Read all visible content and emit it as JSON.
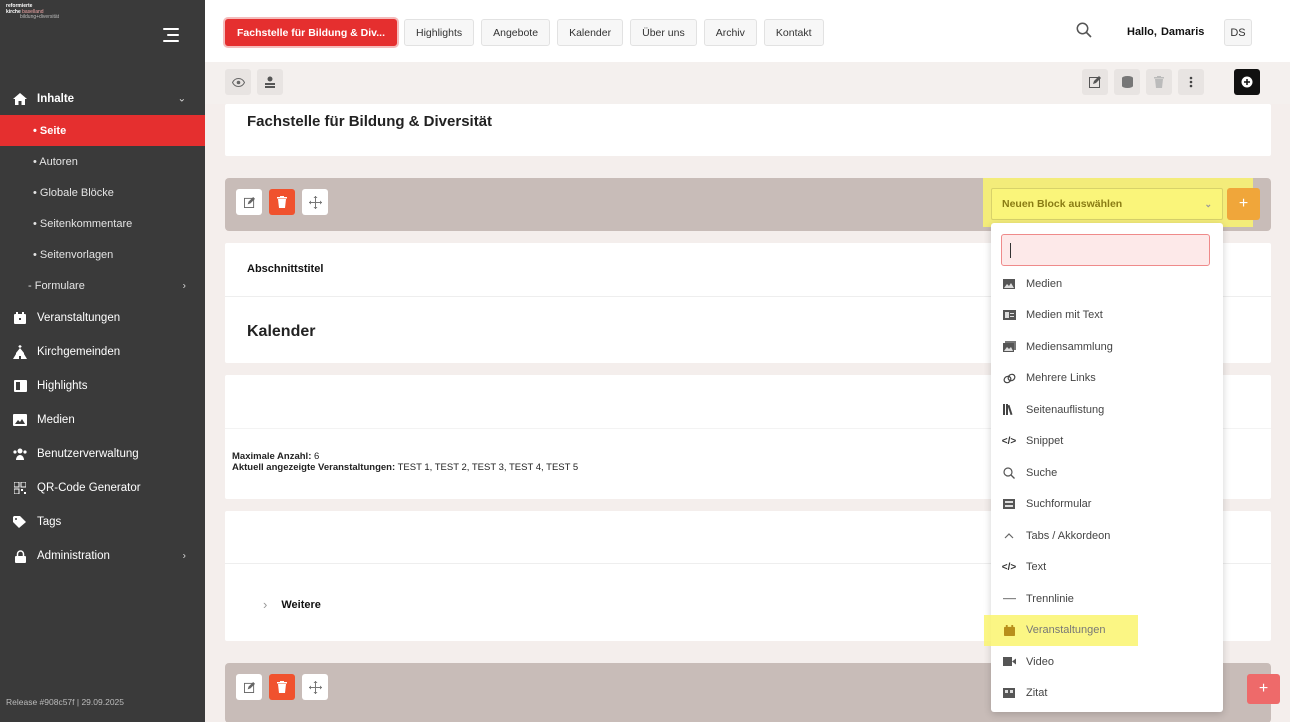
{
  "sidebar": {
    "logo": {
      "line1": "reformierte",
      "line2a": "kirche",
      "line2b": "baselland",
      "line3": "bildung+diversität"
    },
    "items": [
      {
        "label": "Inhalte",
        "icon": "home-icon",
        "chevron": "⌄"
      },
      {
        "label": "• Seite"
      },
      {
        "label": "• Autoren"
      },
      {
        "label": "• Globale Blöcke"
      },
      {
        "label": "• Seitenkommentare"
      },
      {
        "label": "• Seitenvorlagen"
      },
      {
        "label": "- Formulare",
        "chevron": "›"
      },
      {
        "label": "Veranstaltungen",
        "icon": "calendar-icon"
      },
      {
        "label": "Kirchgemeinden",
        "icon": "church-icon"
      },
      {
        "label": "Highlights",
        "icon": "highlights-icon"
      },
      {
        "label": "Medien",
        "icon": "image-icon"
      },
      {
        "label": "Benutzerverwaltung",
        "icon": "users-icon"
      },
      {
        "label": "QR-Code Generator",
        "icon": "qr-code-icon"
      },
      {
        "label": "Tags",
        "icon": "tag-icon"
      },
      {
        "label": "Administration",
        "icon": "lock-icon",
        "chevron": "›"
      }
    ],
    "release": "Release #908c57f | 29.09.2025"
  },
  "topbar": {
    "tabs": [
      "Fachstelle für Bildung & Div...",
      "Highlights",
      "Angebote",
      "Kalender",
      "Über uns",
      "Archiv",
      "Kontakt"
    ],
    "greeting": "Hallo,",
    "user_name": "Damaris",
    "initials": "DS"
  },
  "page": {
    "title": "Fachstelle für Bildung & Diversität",
    "section_label": "Abschnittstitel",
    "section_title": "Kalender",
    "max_label": "Maximale Anzahl:",
    "max_value": "6",
    "events_label": "Aktuell angezeigte Veranstaltungen:",
    "events_value": "TEST 1, TEST 2, TEST 3, TEST 4, TEST 5",
    "more_label": "Weitere"
  },
  "block_select": {
    "label": "Neuen Block auswählen",
    "add": "+"
  },
  "dropdown": {
    "search_value": "",
    "items": [
      {
        "label": "Medien",
        "icon": "image-icon"
      },
      {
        "label": "Medien mit Text",
        "icon": "media-text-icon"
      },
      {
        "label": "Mediensammlung",
        "icon": "gallery-icon"
      },
      {
        "label": "Mehrere Links",
        "icon": "link-icon"
      },
      {
        "label": "Seitenauflistung",
        "icon": "books-icon"
      },
      {
        "label": "Snippet",
        "icon": "code-icon"
      },
      {
        "label": "Suche",
        "icon": "search-icon"
      },
      {
        "label": "Suchformular",
        "icon": "form-icon"
      },
      {
        "label": "Tabs / Akkordeon",
        "icon": "caret-up-icon"
      },
      {
        "label": "Text",
        "icon": "code-icon"
      },
      {
        "label": "Trennlinie",
        "icon": "line-icon"
      },
      {
        "label": "Veranstaltungen",
        "icon": "calendar-icon",
        "highlighted": true
      },
      {
        "label": "Video",
        "icon": "video-icon"
      },
      {
        "label": "Zitat",
        "icon": "quote-icon"
      }
    ]
  },
  "colors": {
    "accent": "#e52f2f",
    "sidebar": "#3a3a3a",
    "highlight": "#faf46e",
    "block_bar": "#c8bcb8",
    "delete": "#f0522e"
  }
}
